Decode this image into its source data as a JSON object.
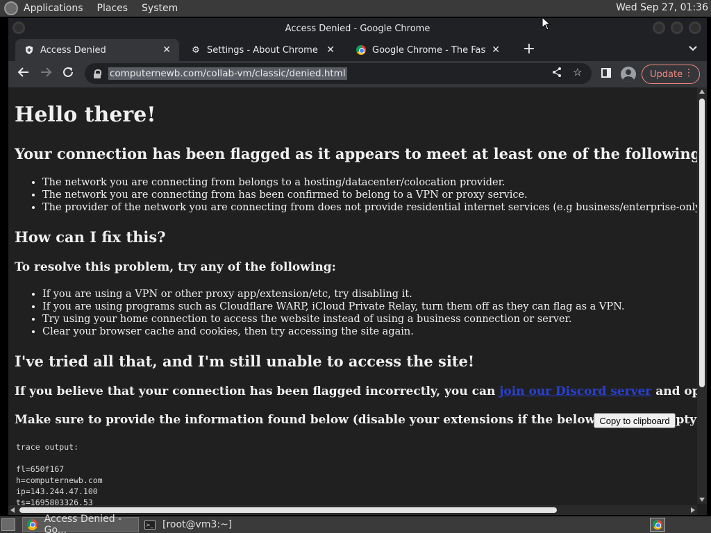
{
  "top_panel": {
    "menus": [
      "Applications",
      "Places",
      "System"
    ],
    "clock": "Wed Sep 27, 01:36"
  },
  "window": {
    "title": "Access Denied - Google Chrome"
  },
  "tabs": [
    {
      "label": "Access Denied",
      "icon": "shield-icon",
      "active": true
    },
    {
      "label": "Settings - About Chrome",
      "icon": "gear-icon",
      "active": false
    },
    {
      "label": "Google Chrome - The Fast & Se",
      "icon": "chrome-icon",
      "active": false
    }
  ],
  "toolbar": {
    "url": "computernewb.com/collab-vm/classic/denied.html",
    "update_label": "Update"
  },
  "page": {
    "h1": "Hello there!",
    "criteria_heading": "Your connection has been flagged as it appears to meet at least one of the following criteria:",
    "criteria": [
      "The network you are connecting from belongs to a hosting/datacenter/colocation provider.",
      "The network you are connecting from has been confirmed to belong to a VPN or proxy service.",
      "The provider of the network you are connecting from does not provide residential internet services (e.g business/enterprise-only networks)."
    ],
    "fix_heading": "How can I fix this?",
    "resolve_heading": "To resolve this problem, try any of the following:",
    "fixes": [
      "If you are using a VPN or other proxy app/extension/etc, try disabling it.",
      "If you are using programs such as Cloudflare WARP, iCloud Private Relay, turn them off as they can flag as a VPN.",
      "Try using your home connection to access the website instead of using a business connection or server.",
      "Clear your browser cache and cookies, then try accessing the site again."
    ],
    "tried_heading": "I've tried all that, and I'm still unable to access the site!",
    "believe_prefix": "If you believe that your connection has been flagged incorrectly, you can ",
    "discord_link": "join our Discord server",
    "believe_suffix": " and open a ticket.",
    "provide_info": "Make sure to provide the information found below (disable your extensions if the below space is empty):",
    "copy_button": "Copy to clipboard",
    "trace_label": "trace output:",
    "trace_lines": [
      "fl=650f167",
      "h=computernewb.com",
      "ip=143.244.47.100",
      "ts=1695803326.53"
    ]
  },
  "taskbar": {
    "tasks": [
      {
        "label": "Access Denied - Go...",
        "icon": "chrome-icon",
        "active": true
      },
      {
        "label": "[root@vm3:~]",
        "icon": "terminal-icon",
        "active": false
      }
    ]
  },
  "colors": {
    "page_bg": "#202020",
    "chrome_frame": "#202124",
    "toolbar": "#35363a",
    "update_accent": "#f28b82",
    "link": "#2a40d0"
  }
}
